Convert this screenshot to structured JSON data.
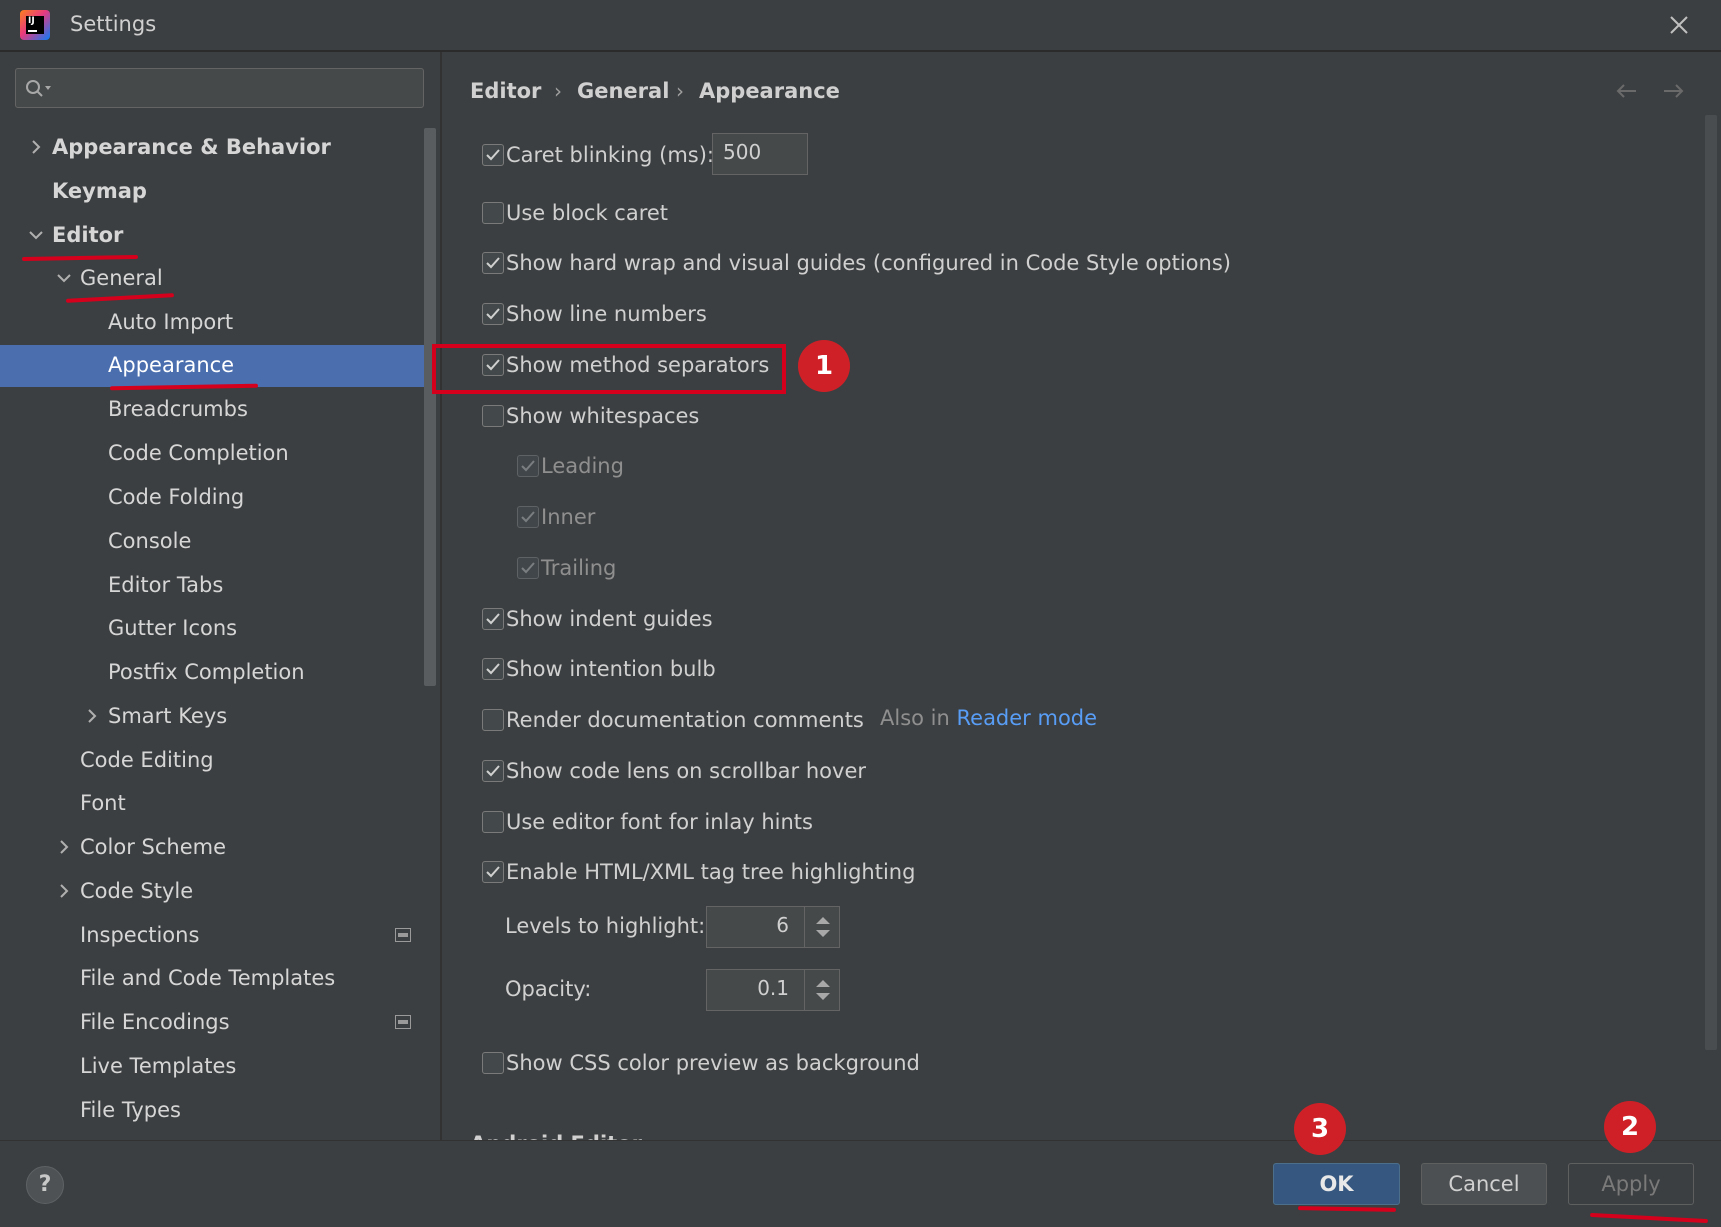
{
  "window": {
    "title": "Settings"
  },
  "search": {
    "placeholder": ""
  },
  "tree": {
    "items": [
      {
        "label": "Appearance & Behavior",
        "level": 0,
        "bold": true,
        "expandable": true,
        "expanded": false
      },
      {
        "label": "Keymap",
        "level": 0,
        "bold": true,
        "expandable": false
      },
      {
        "label": "Editor",
        "level": 0,
        "bold": true,
        "expandable": true,
        "expanded": true
      },
      {
        "label": "General",
        "level": 1,
        "expandable": true,
        "expanded": true
      },
      {
        "label": "Auto Import",
        "level": 2
      },
      {
        "label": "Appearance",
        "level": 2,
        "selected": true
      },
      {
        "label": "Breadcrumbs",
        "level": 2
      },
      {
        "label": "Code Completion",
        "level": 2
      },
      {
        "label": "Code Folding",
        "level": 2
      },
      {
        "label": "Console",
        "level": 2
      },
      {
        "label": "Editor Tabs",
        "level": 2
      },
      {
        "label": "Gutter Icons",
        "level": 2
      },
      {
        "label": "Postfix Completion",
        "level": 2
      },
      {
        "label": "Smart Keys",
        "level": 2,
        "expandable": true,
        "expanded": false
      },
      {
        "label": "Code Editing",
        "level": 1
      },
      {
        "label": "Font",
        "level": 1
      },
      {
        "label": "Color Scheme",
        "level": 1,
        "expandable": true,
        "expanded": false
      },
      {
        "label": "Code Style",
        "level": 1,
        "expandable": true,
        "expanded": false
      },
      {
        "label": "Inspections",
        "level": 1,
        "has_icon": true
      },
      {
        "label": "File and Code Templates",
        "level": 1
      },
      {
        "label": "File Encodings",
        "level": 1,
        "has_icon": true
      },
      {
        "label": "Live Templates",
        "level": 1
      },
      {
        "label": "File Types",
        "level": 1
      }
    ]
  },
  "breadcrumb": {
    "items": [
      "Editor",
      "General",
      "Appearance"
    ]
  },
  "options": {
    "caret_blinking": {
      "label": "Caret blinking (ms):",
      "checked": true,
      "value": "500"
    },
    "block_caret": {
      "label": "Use block caret",
      "checked": false
    },
    "hard_wrap": {
      "label": "Show hard wrap and visual guides (configured in Code Style options)",
      "checked": true
    },
    "line_numbers": {
      "label": "Show line numbers",
      "checked": true
    },
    "method_separators": {
      "label": "Show method separators",
      "checked": true
    },
    "whitespaces": {
      "label": "Show whitespaces",
      "checked": false
    },
    "leading": {
      "label": "Leading",
      "checked": true,
      "disabled": true
    },
    "inner": {
      "label": "Inner",
      "checked": true,
      "disabled": true
    },
    "trailing": {
      "label": "Trailing",
      "checked": true,
      "disabled": true
    },
    "indent_guides": {
      "label": "Show indent guides",
      "checked": true
    },
    "intention_bulb": {
      "label": "Show intention bulb",
      "checked": true
    },
    "render_docs": {
      "label": "Render documentation comments",
      "checked": false,
      "hint": "Also in",
      "link": "Reader mode"
    },
    "code_lens": {
      "label": "Show code lens on scrollbar hover",
      "checked": true
    },
    "editor_font_inlay": {
      "label": "Use editor font for inlay hints",
      "checked": false
    },
    "tag_tree": {
      "label": "Enable HTML/XML tag tree highlighting",
      "checked": true
    },
    "levels": {
      "label": "Levels to highlight:",
      "value": "6"
    },
    "opacity": {
      "label": "Opacity:",
      "value": "0.1"
    },
    "css_color_preview": {
      "label": "Show CSS color preview as background",
      "checked": false
    }
  },
  "cut_section_label": "Android Editor",
  "buttons": {
    "help": "?",
    "ok": "OK",
    "cancel": "Cancel",
    "apply": "Apply"
  },
  "annotations": {
    "step1": "1",
    "step2": "2",
    "step3": "3",
    "color": "#d5001c"
  },
  "colors": {
    "background": "#3c3f41",
    "selection": "#4b6eaf",
    "link": "#589df6",
    "ok_button": "#365880",
    "annotation": "#d02027"
  }
}
